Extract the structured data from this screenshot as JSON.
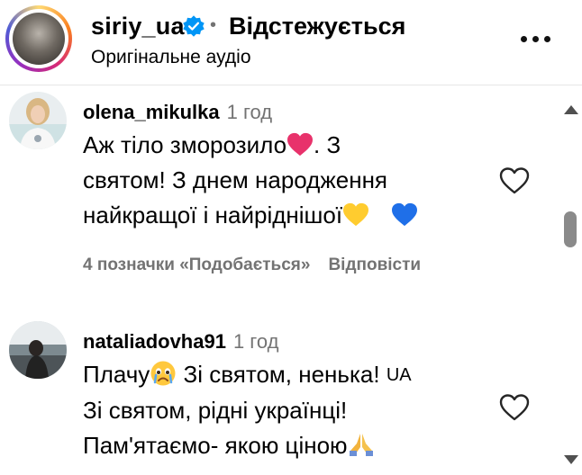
{
  "header": {
    "username": "siriy_ua",
    "dot": "•",
    "follow_status": "Відстежується",
    "audio": "Оригінальне аудіо"
  },
  "comments": [
    {
      "username": "olena_mikulka",
      "time": "1 год",
      "lines": [
        "Аж тіло зморозило",
        ". З",
        "святом! З днем народження",
        "найкращої і найріднішої"
      ],
      "likes_label": "4 позначки «Подобається»",
      "reply_label": "Відповісти"
    },
    {
      "username": "nataliadovha91",
      "time": "1 год",
      "lines": [
        "Плачу",
        " Зі святом, ненька! ",
        "UA",
        "Зі святом, рідні українці!",
        "Пам'ятаємо- якою ціною"
      ]
    }
  ],
  "colors": {
    "secondary_text": "#737373",
    "verified_blue": "#0095f6",
    "heart_red": "#e8326b",
    "heart_yellow": "#ffcc2f",
    "heart_blue": "#1f6fe8"
  },
  "icons": [
    "verified-badge-icon",
    "more-options-icon",
    "heart-icon",
    "red-heart-emoji",
    "yellow-heart-emoji",
    "blue-heart-emoji",
    "crying-face-emoji",
    "ua-flag-letters",
    "praying-hands-emoji",
    "scroll-up-arrow",
    "scroll-down-arrow"
  ]
}
